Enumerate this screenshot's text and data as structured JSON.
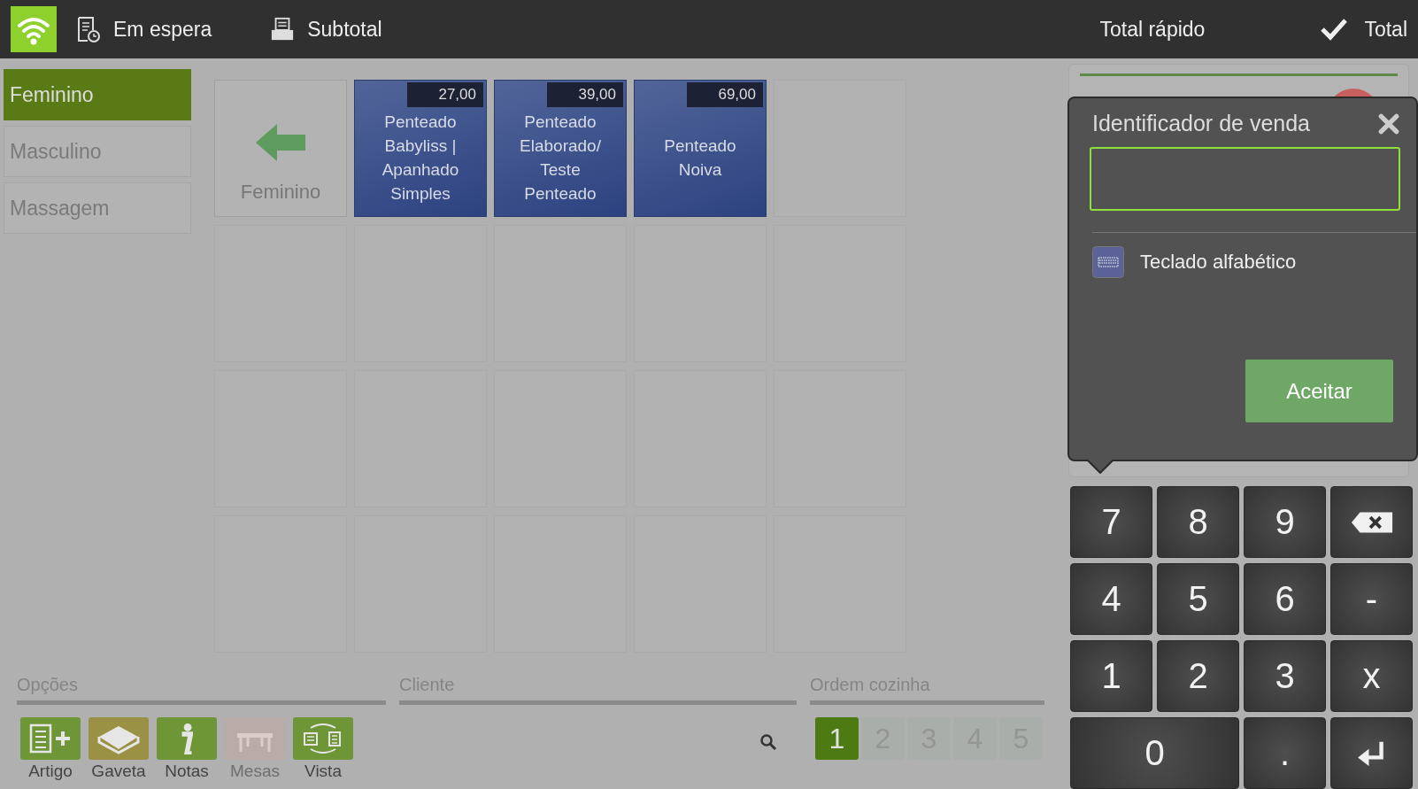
{
  "top_bar": {
    "actions": [
      {
        "kind": "hold",
        "label": "Em espera"
      },
      {
        "kind": "print",
        "label": "Subtotal"
      }
    ],
    "right_actions": [
      {
        "kind": "plain",
        "label": "Total rápido"
      },
      {
        "kind": "check",
        "label": "Total"
      }
    ]
  },
  "categories": [
    {
      "label": "Feminino",
      "selected": true
    },
    {
      "label": "Masculino",
      "selected": false
    },
    {
      "label": "Massagem",
      "selected": false
    }
  ],
  "back_tile": {
    "label": "Feminino"
  },
  "products": [
    {
      "name": "Penteado Babyliss | Apanhado Simples",
      "price": "27,00"
    },
    {
      "name": "Penteado Elaborado/ Teste Penteado",
      "price": "39,00"
    },
    {
      "name": "Penteado Noiva",
      "price": "69,00"
    }
  ],
  "options": {
    "title": "Opções",
    "items": [
      {
        "kind": "article",
        "label": "Artigo",
        "color": "#6e9637",
        "disabled": false
      },
      {
        "kind": "drawer",
        "label": "Gaveta",
        "color": "#9a9144",
        "disabled": false
      },
      {
        "kind": "notes",
        "label": "Notas",
        "color": "#6e9637",
        "disabled": false
      },
      {
        "kind": "tables",
        "label": "Mesas",
        "color": "#b9aca8",
        "disabled": true
      },
      {
        "kind": "view",
        "label": "Vista",
        "color": "#6e9637",
        "disabled": false
      }
    ]
  },
  "client": {
    "title": "Cliente"
  },
  "kitchen_order": {
    "title": "Ordem cozinha",
    "items": [
      {
        "label": "1",
        "selected": true
      },
      {
        "label": "2",
        "selected": false
      },
      {
        "label": "3",
        "selected": false
      },
      {
        "label": "4",
        "selected": false
      },
      {
        "label": "5",
        "selected": false
      }
    ]
  },
  "popover": {
    "title": "Identificador de venda",
    "keyboard_option": "Teclado alfabético",
    "accept": "Aceitar"
  },
  "keypad": [
    {
      "kind": "text",
      "label": "7"
    },
    {
      "kind": "text",
      "label": "8"
    },
    {
      "kind": "text",
      "label": "9"
    },
    {
      "kind": "backspace"
    },
    {
      "kind": "text",
      "label": "4"
    },
    {
      "kind": "text",
      "label": "5"
    },
    {
      "kind": "text",
      "label": "6"
    },
    {
      "kind": "text",
      "label": "-"
    },
    {
      "kind": "text",
      "label": "1"
    },
    {
      "kind": "text",
      "label": "2"
    },
    {
      "kind": "text",
      "label": "3"
    },
    {
      "kind": "text",
      "label": "x"
    },
    {
      "kind": "wide",
      "label": "0"
    },
    {
      "kind": "text",
      "label": "."
    },
    {
      "kind": "enter"
    }
  ]
}
